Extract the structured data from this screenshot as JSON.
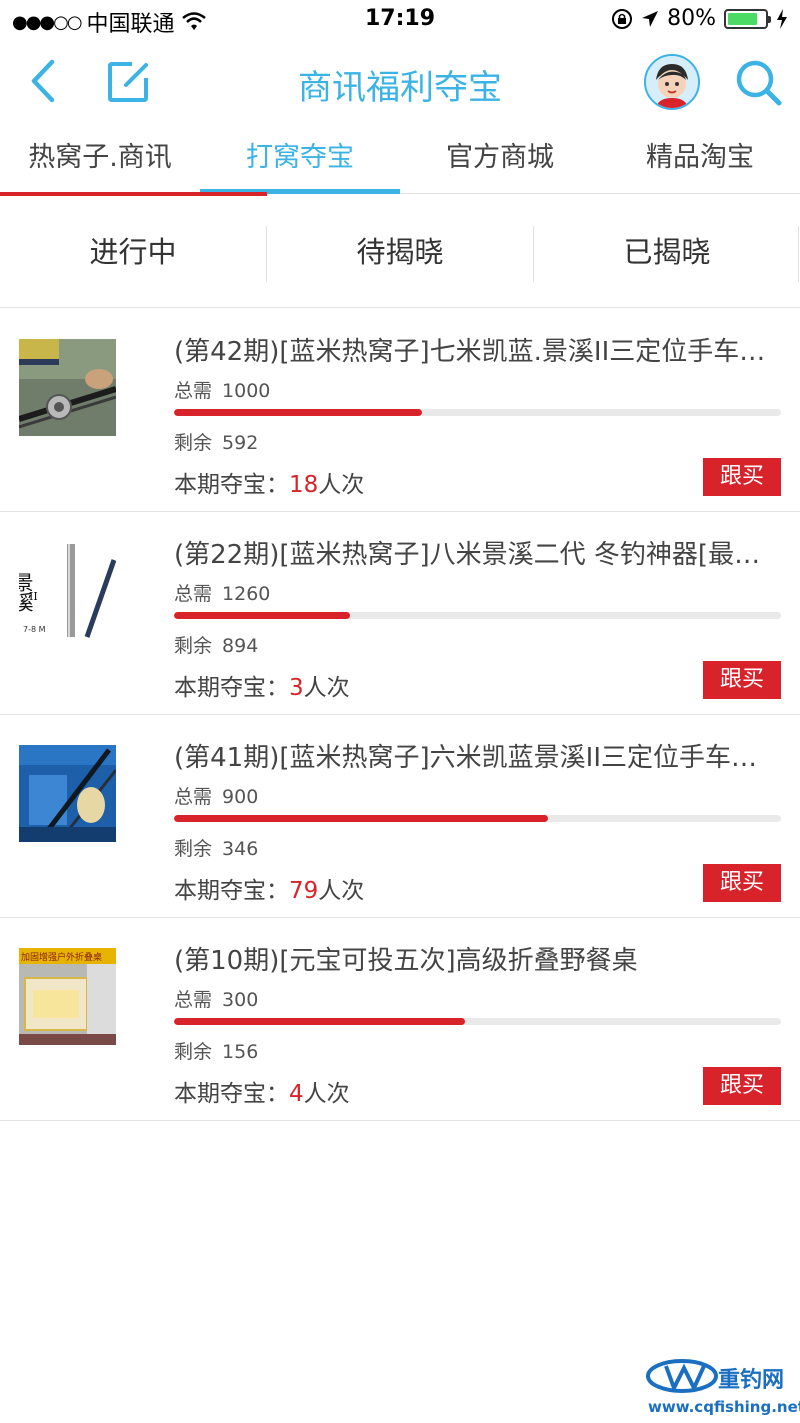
{
  "status_bar": {
    "signal": "●●●○○",
    "carrier": "中国联通",
    "time": "17:19",
    "battery": "80%",
    "battery_level": 0.8
  },
  "nav": {
    "title": "商讯福利夺宝"
  },
  "top_tabs": [
    {
      "label": "热窝子.商讯"
    },
    {
      "label": "打窝夺宝"
    },
    {
      "label": "官方商城"
    },
    {
      "label": "精品淘宝"
    }
  ],
  "active_top_tab": 1,
  "sub_tabs": [
    {
      "label": "进行中"
    },
    {
      "label": "待揭晓"
    },
    {
      "label": "已揭晓"
    }
  ],
  "labels": {
    "total": "总需",
    "remaining": "剩余",
    "bid_prefix": "本期夺宝：",
    "bid_suffix": "人次",
    "buy": "跟买"
  },
  "items": [
    {
      "title": "(第42期)[蓝米热窝子]七米凯蓝.景溪II三定位手车…",
      "total": "1000",
      "remaining": "592",
      "progress": 0.408,
      "count": "18"
    },
    {
      "title": "(第22期)[蓝米热窝子]八米景溪二代 冬钓神器[最…",
      "total": "1260",
      "remaining": "894",
      "progress": 0.29,
      "count": "3"
    },
    {
      "title": "(第41期)[蓝米热窝子]六米凯蓝景溪II三定位手车…",
      "total": "900",
      "remaining": "346",
      "progress": 0.616,
      "count": "79"
    },
    {
      "title": "(第10期)[元宝可投五次]高级折叠野餐桌",
      "total": "300",
      "remaining": "156",
      "progress": 0.48,
      "count": "4"
    }
  ],
  "thumb_text": {
    "jingxi": "景溪",
    "jingxi_2": "II",
    "jingxi_len": "7-8 M",
    "table_banner": "加固增强户外折叠桌"
  },
  "watermark": {
    "name": "重钓网",
    "url": "www.cqfishing.net"
  },
  "colors": {
    "accent": "#3bb3e5",
    "red": "#d8232a"
  }
}
